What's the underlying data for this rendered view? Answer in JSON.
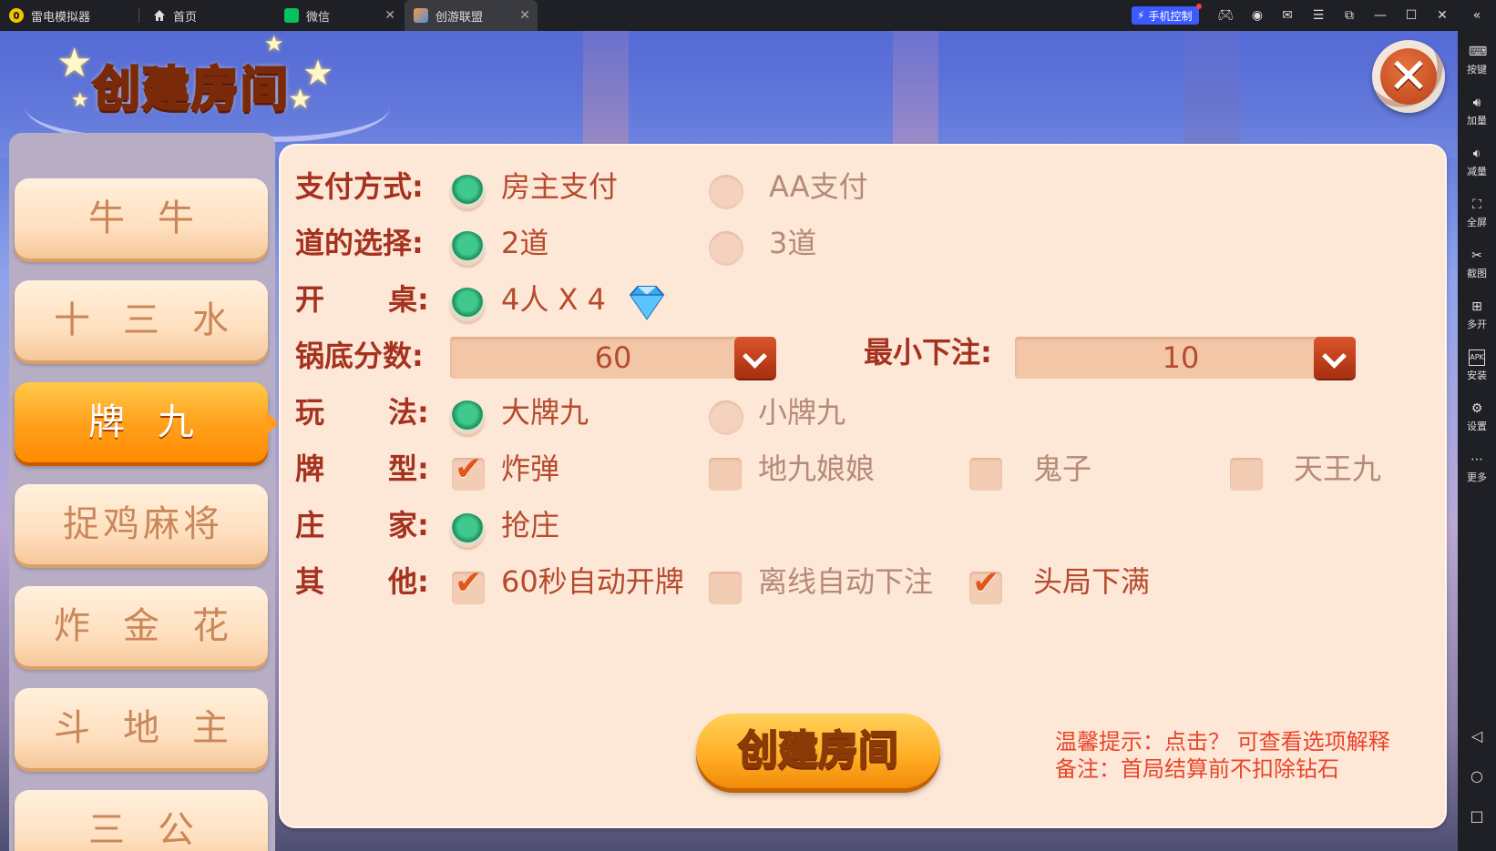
{
  "window": {
    "tabs": [
      {
        "label": "雷电模拟器",
        "icon": "leidian-logo-icon"
      },
      {
        "label": "首页",
        "icon": "home-icon"
      },
      {
        "label": "微信",
        "icon": "wechat-icon"
      },
      {
        "label": "创游联盟",
        "icon": "game-icon"
      }
    ],
    "phone_control": "手机控制"
  },
  "sidebar": {
    "items": [
      {
        "label": "按键",
        "icon": "keyboard-icon"
      },
      {
        "label": "加量",
        "icon": "volume-up-icon"
      },
      {
        "label": "减量",
        "icon": "volume-down-icon"
      },
      {
        "label": "全屏",
        "icon": "fullscreen-icon"
      },
      {
        "label": "截图",
        "icon": "scissors-icon"
      },
      {
        "label": "多开",
        "icon": "multi-instance-icon"
      },
      {
        "label": "安装",
        "icon": "apk-install-icon"
      },
      {
        "label": "设置",
        "icon": "settings-icon"
      },
      {
        "label": "更多",
        "icon": "more-icon"
      }
    ]
  },
  "dialog": {
    "title": "创建房间",
    "games": [
      "牛牛",
      "十三水",
      "牌九",
      "捉鸡麻将",
      "炸金花",
      "斗地主",
      "三公"
    ],
    "active_game": "牌九",
    "payment": {
      "label": "支付方式:",
      "options": [
        "房主支付",
        "AA支付"
      ],
      "selected": "房主支付"
    },
    "lanes": {
      "label": "道的选择:",
      "options": [
        "2道",
        "3道"
      ],
      "selected": "2道"
    },
    "table": {
      "label_a": "开",
      "label_b": "桌:",
      "option": "4人 X 4"
    },
    "base_score": {
      "label": "锅底分数:",
      "value": "60"
    },
    "min_bet": {
      "label": "最小下注:",
      "value": "10"
    },
    "play_mode": {
      "label_a": "玩",
      "label_b": "法:",
      "options": [
        "大牌九",
        "小牌九"
      ],
      "selected": "大牌九"
    },
    "card_types": {
      "label_a": "牌",
      "label_b": "型:",
      "options": [
        {
          "text": "炸弹",
          "checked": true
        },
        {
          "text": "地九娘娘",
          "checked": false
        },
        {
          "text": "鬼子",
          "checked": false
        },
        {
          "text": "天王九",
          "checked": false
        }
      ]
    },
    "banker": {
      "label_a": "庄",
      "label_b": "家:",
      "option": "抢庄"
    },
    "other": {
      "label_a": "其",
      "label_b": "他:",
      "options": [
        {
          "text": "60秒自动开牌",
          "checked": true
        },
        {
          "text": "离线自动下注",
          "checked": false
        },
        {
          "text": "头局下满",
          "checked": true
        }
      ]
    },
    "create_button": "创建房间",
    "tips": [
      "温馨提示：点击？ 可查看选项解释",
      "备注：首局结算前不扣除钻石"
    ]
  }
}
